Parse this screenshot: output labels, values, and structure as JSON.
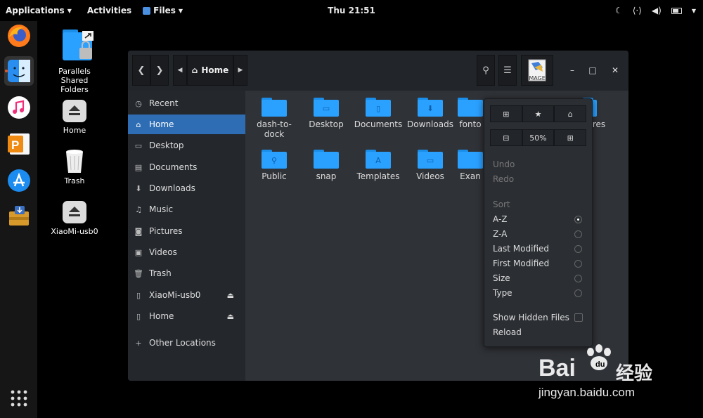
{
  "topbar": {
    "applications": "Applications",
    "activities": "Activities",
    "files": "Files",
    "clock": "Thu 21:51"
  },
  "desktop_icons": [
    {
      "label": "Parallels Shared Folders"
    },
    {
      "label": "Home"
    },
    {
      "label": "Trash"
    },
    {
      "label": "XiaoMi-usb0"
    }
  ],
  "headerbar": {
    "location": "Home",
    "image_label": "IMAGE"
  },
  "sidebar": {
    "items": [
      {
        "label": "Recent"
      },
      {
        "label": "Home"
      },
      {
        "label": "Desktop"
      },
      {
        "label": "Documents"
      },
      {
        "label": "Downloads"
      },
      {
        "label": "Music"
      },
      {
        "label": "Pictures"
      },
      {
        "label": "Videos"
      },
      {
        "label": "Trash"
      },
      {
        "label": "XiaoMi-usb0"
      },
      {
        "label": "Home"
      },
      {
        "label": "Other Locations"
      }
    ]
  },
  "files": [
    {
      "name": "dash-to-dock"
    },
    {
      "name": "Desktop"
    },
    {
      "name": "Documents"
    },
    {
      "name": "Downloads"
    },
    {
      "name": "fonto"
    },
    {
      "name": "res"
    },
    {
      "name": "Public"
    },
    {
      "name": "snap"
    },
    {
      "name": "Templates"
    },
    {
      "name": "Videos"
    },
    {
      "name": "Exan"
    }
  ],
  "menu": {
    "zoom": "50%",
    "undo": "Undo",
    "redo": "Redo",
    "sort_heading": "Sort",
    "sort_options": [
      {
        "label": "A-Z"
      },
      {
        "label": "Z-A"
      },
      {
        "label": "Last Modified"
      },
      {
        "label": "First Modified"
      },
      {
        "label": "Size"
      },
      {
        "label": "Type"
      }
    ],
    "selected_sort": "A-Z",
    "show_hidden": "Show Hidden Files",
    "reload": "Reload"
  },
  "watermark": {
    "brand_left": "Bai",
    "brand_right": "经验",
    "url": "jingyan.baidu.com"
  }
}
